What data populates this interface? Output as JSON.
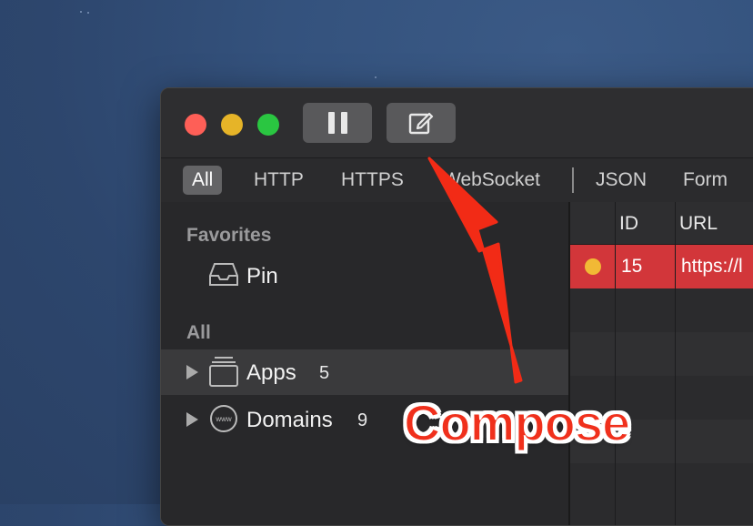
{
  "toolbar": {
    "pause_icon": "pause-icon",
    "compose_icon": "compose-icon"
  },
  "filters": [
    "All",
    "HTTP",
    "HTTPS",
    "WebSocket",
    "JSON",
    "Form"
  ],
  "sidebar": {
    "favorites_heading": "Favorites",
    "pin_label": "Pin",
    "all_heading": "All",
    "apps": {
      "label": "Apps",
      "count": "5"
    },
    "domains": {
      "label": "Domains",
      "count": "9"
    }
  },
  "table": {
    "columns": [
      "ID",
      "URL"
    ],
    "rows": [
      {
        "id": "15",
        "url": "https://l",
        "status_color": "#f1b935"
      }
    ]
  },
  "annotation": {
    "text": "Compose",
    "color": "#f0301c"
  },
  "colors": {
    "traffic_close": "#fe5f57",
    "traffic_min": "#e6b428",
    "traffic_max": "#2ac641",
    "selected_row": "#d2363a"
  }
}
